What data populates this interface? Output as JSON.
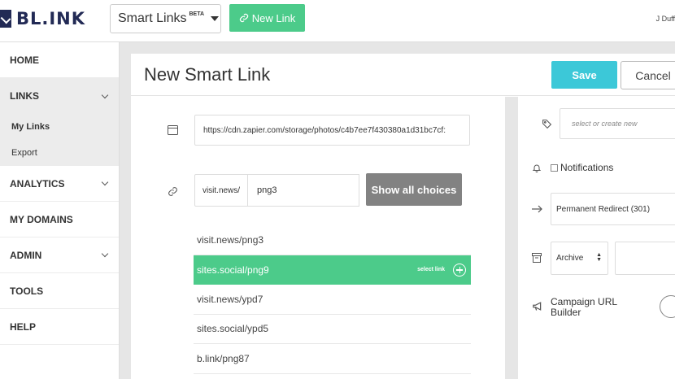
{
  "brand": {
    "logo_text": "BL.INK",
    "accent": "#4ccb8a",
    "primary_dark": "#222a55"
  },
  "header": {
    "product_select": "Smart Links",
    "product_badge": "BETA",
    "new_link_label": "New Link",
    "user_name": "J Duff"
  },
  "sidebar": {
    "home": "HOME",
    "links": "LINKS",
    "links_sub": [
      "My Links",
      "Export"
    ],
    "analytics": "ANALYTICS",
    "my_domains": "MY DOMAINS",
    "admin": "ADMIN",
    "tools": "TOOLS",
    "help": "HELP"
  },
  "page": {
    "title": "New Smart Link",
    "save_label": "Save",
    "cancel_label": "Cancel"
  },
  "form": {
    "destination_url": "https://cdn.zapier.com/storage/photos/c4b7ee7f430380a1d31bc7cf:",
    "domain_prefix": "visit.news/",
    "slug_value": "png3",
    "show_choices_label": "Show all choices",
    "choices": [
      {
        "label": "visit.news/png3",
        "selected": false
      },
      {
        "label": "sites.social/png9",
        "selected": true
      },
      {
        "label": "visit.news/ypd7",
        "selected": false
      },
      {
        "label": "sites.social/ypd5",
        "selected": false
      },
      {
        "label": "b.link/png87",
        "selected": false
      }
    ],
    "select_link_label": "select link"
  },
  "options": {
    "tags_placeholder": "select or create new",
    "notifications_label": "Notifications",
    "redirect_value": "Permanent Redirect (301)",
    "archive_value": "Archive",
    "campaign_label": "Campaign URL Builder"
  }
}
